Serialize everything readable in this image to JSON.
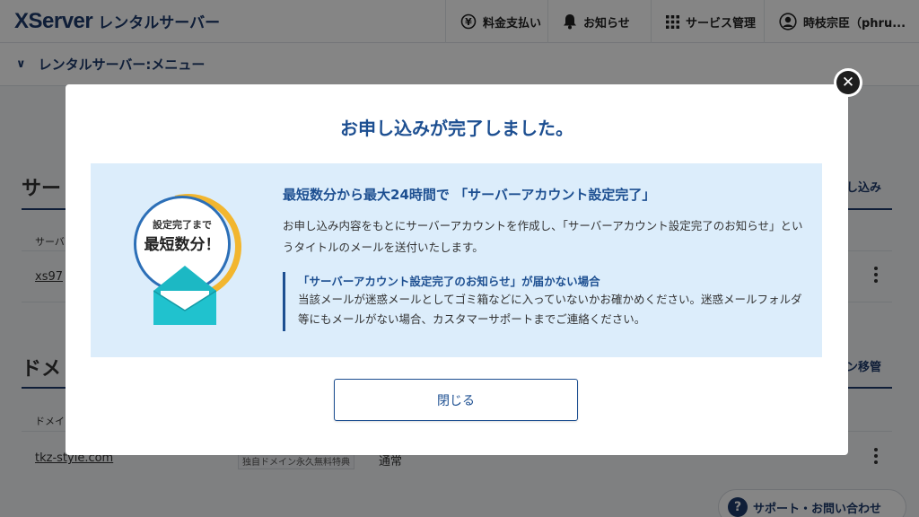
{
  "header": {
    "logo_main": "XServer",
    "logo_sub": "レンタルサーバー",
    "nav": {
      "billing": "料金支払い",
      "notice": "お知らせ",
      "service": "サービス管理",
      "user": "時枝宗臣（phru..."
    }
  },
  "menubar": {
    "title": "レンタルサーバー:メニュー"
  },
  "background": {
    "server_section_title": "サー",
    "server_section_action": "し込み",
    "server_col_head": "サーバ",
    "server_row_link": "xs97",
    "domain_section_title": "ドメ",
    "domain_section_action": "ン移管",
    "domain_col_head": "ドメイ",
    "domain_row_link": "tkz-style.com",
    "domain_row_tag": "独自ドメイン永久無料特典",
    "domain_row_status": "通常",
    "support_label": "サポート・お問い合わせ"
  },
  "modal": {
    "title": "お申し込みが完了しました。",
    "badge_small": "設定完了まで",
    "badge_big": "最短数分！",
    "heading": "最短数分から最大24時間で 「サーバーアカウント設定完了」",
    "body": "お申し込み内容をもとにサーバーアカウントを作成し、「サーバーアカウント設定完了のお知らせ」というタイトルのメールを送付いたします。",
    "notice_title": "「サーバーアカウント設定完了のお知らせ」が届かない場合",
    "notice_body": "当該メールが迷惑メールとしてゴミ箱などに入っていないかお確かめください。迷惑メールフォルダ等にもメールがない場合、カスタマーサポートまでご連絡ください。",
    "close_button": "閉じる"
  },
  "colors": {
    "brand_navy": "#1d3a6b",
    "accent_blue": "#1d4f91",
    "info_bg": "#dcedfb",
    "badge_yellow": "#f2b62f",
    "envelope_teal": "#1cb8c4"
  }
}
